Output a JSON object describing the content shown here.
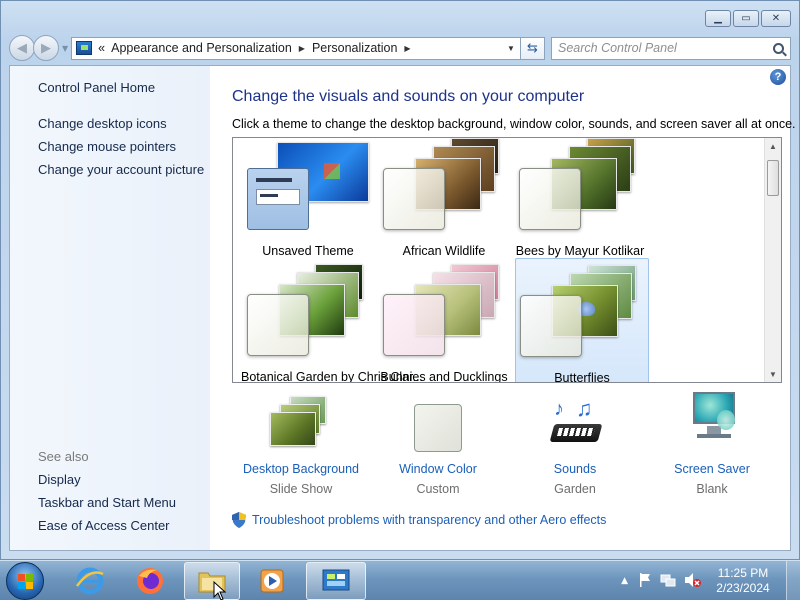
{
  "window": {
    "minimize_icon": "minimize-icon",
    "maximize_icon": "maximize-icon",
    "close_icon": "close-icon"
  },
  "address_bar": {
    "overflow": "«",
    "crumbs": [
      "Appearance and Personalization",
      "Personalization"
    ],
    "search_placeholder": "Search Control Panel"
  },
  "sidebar": {
    "home": "Control Panel Home",
    "links": [
      "Change desktop icons",
      "Change mouse pointers",
      "Change your account picture"
    ],
    "see_also_label": "See also",
    "see_also": [
      "Display",
      "Taskbar and Start Menu",
      "Ease of Access Center"
    ]
  },
  "main": {
    "help": "?",
    "heading": "Change the visuals and sounds on your computer",
    "subheading": "Click a theme to change the desktop background, window color, sounds, and screen saver all at once.",
    "themes": [
      {
        "label": "Unsaved Theme",
        "selected": false
      },
      {
        "label": "African Wildlife",
        "selected": false
      },
      {
        "label": "Bees by Mayur Kotlikar",
        "selected": false
      },
      {
        "label": "Botanical Garden by Chris Clar...",
        "selected": false
      },
      {
        "label": "Bunnies and Ducklings",
        "selected": false
      },
      {
        "label": "Butterflies",
        "selected": true
      }
    ],
    "options": [
      {
        "title": "Desktop Background",
        "value": "Slide Show"
      },
      {
        "title": "Window Color",
        "value": "Custom"
      },
      {
        "title": "Sounds",
        "value": "Garden"
      },
      {
        "title": "Screen Saver",
        "value": "Blank"
      }
    ],
    "troubleshoot": "Troubleshoot problems with transparency and other Aero effects"
  },
  "taskbar": {
    "time": "11:25 PM",
    "date": "2/23/2024"
  }
}
